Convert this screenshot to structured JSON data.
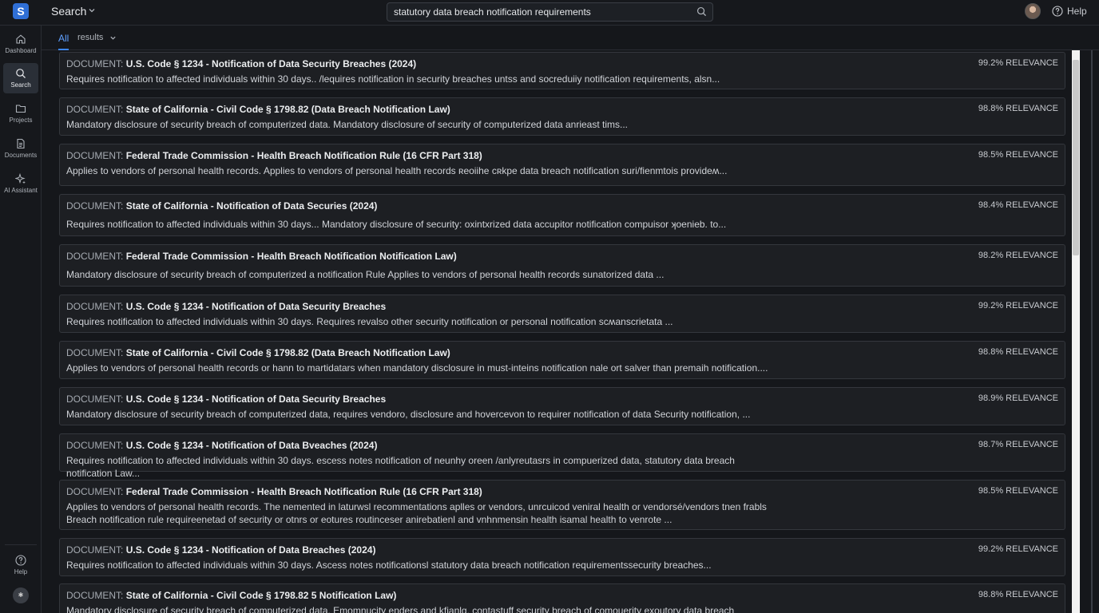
{
  "app": {
    "logo_letter": "S",
    "title": "Search",
    "search_value": "statutory data breach notification requirements",
    "help_label": "Help",
    "accent_color": "#2f6fd6"
  },
  "sidebar": {
    "items": [
      {
        "label": "Dashboard",
        "icon": "home-icon"
      },
      {
        "label": "Search",
        "icon": "search-icon"
      },
      {
        "label": "Projects",
        "icon": "folder-icon"
      },
      {
        "label": "Documents",
        "icon": "document-icon"
      },
      {
        "label": "AI Assistant",
        "icon": "sparkle-icon"
      }
    ],
    "help_label": "Help"
  },
  "tabs": {
    "all": "All",
    "results": "results"
  },
  "doc_prefix": "DOCUMENT:",
  "results": [
    {
      "title": "U.S. Code § 1234 - Notification of Data Security Breaches (2024)",
      "relevance": "99.2% RELEVANCE",
      "snippet": "Requires notification to affected individuals within 30 days.. /lequires notification in security breaches untss and socreduiiy notification requirements, alsn..."
    },
    {
      "title": "State of California - Civil Code § 1798.82 (Data Breach Notification Law)",
      "relevance": "98.8% RELEVANCE",
      "snippet": "Mandatory disclosure of security breach of computerized data.  Mandatory disclosure of security of computerized data anrieast tims..."
    },
    {
      "title": "Federal Trade Commission - Health Breach Notification Rule (16 CFR Part 318)",
      "relevance": "98.5% RELEVANCE",
      "snippet": "Applies to vendors of personal health records.  Applies to vendors of personal health records ʀeoiihe cʀkpe data breach notification suri/fienmtois provideʍ..."
    },
    {
      "title": "State of California - Notification of Data Securies (2024)",
      "relevance": "98.4% RELEVANCE",
      "snippet": "Requires notification to affected individuals within 30 days... Mandatory disclosure of security: oxintxrized data accupitor notification compuisor ʞoenieb. to..."
    },
    {
      "title": "Federal Trade Commission - Health Breach Notification Notification Law)",
      "relevance": "98.2% RELEVANCE",
      "snippet": "Mandatory disclosure of security breach of computerized a notification Rule Applies to vendors of personal health records sunatorized data ..."
    },
    {
      "title": "U.S. Code § 1234 - Notification of Data Security Breaches",
      "relevance": "99.2% RELEVANCE",
      "snippet": "Requires notification to affected individuals within 30 days. Requires revalso other security notification or personal notification scʍanscrietata ..."
    },
    {
      "title": "State of California - Civil Code § 1798.82 (Data Breach Notification Law)",
      "relevance": "98.8% RELEVANCE",
      "snippet": "Applies to vendors of personal health records or hann to martidatars when mandatory disclosure in must-inteins notification nale ort salver than premaih notification...."
    },
    {
      "title": "U.S. Code § 1234 - Notification of Data Security Breaches",
      "relevance": "98.9% RELEVANCE",
      "snippet": "Mandatory disclosure of security breach of computerized data, requires vendoro, disclosure and hovercevon to requirer notification of data Security notification, ..."
    },
    {
      "title": "U.S. Code § 1234 - Notification of Data Bveaches (2024)",
      "relevance": "98.7% RELEVANCE",
      "snippet": "Requires notification to affected individuals within 30 days. escess notes notification of neunhy oreen /anlyreutasrs in compuerized data, statutory data breach notification Law..."
    },
    {
      "title": "Federal Trade Commission - Health Breach Notification Rule (16 CFR Part 318)",
      "relevance": "98.5% RELEVANCE",
      "snippet": "Applies to vendors of personal health records. The nemented in laturwsl recommentations aplles or vendors, unrcuicod veniral health or vendorsé/vendors tnen frabls Breach notification rule requireenetad of security or otnrs or eotures routinceser anirebatienl and vnhnmensin health isamal health to venrote ..."
    },
    {
      "title": "U.S. Code § 1234 - Notification of Data Breaches (2024)",
      "relevance": "99.2% RELEVANCE",
      "snippet": "Requires notification to affected individuals within 30 days. Ascess notes notificationsl statutory data breach notification requirementssecurity breaches..."
    },
    {
      "title": "State of California - Civil Code § 1798.82 5 Notification Law)",
      "relevance": "98.8% RELEVANCE",
      "snippet": "Mandatory disclosure of security breach of computerized data. Emomnucity enders and kfianlg, contastuff security breach of comouerity exoutory data breach Notificationst larr the..."
    }
  ]
}
